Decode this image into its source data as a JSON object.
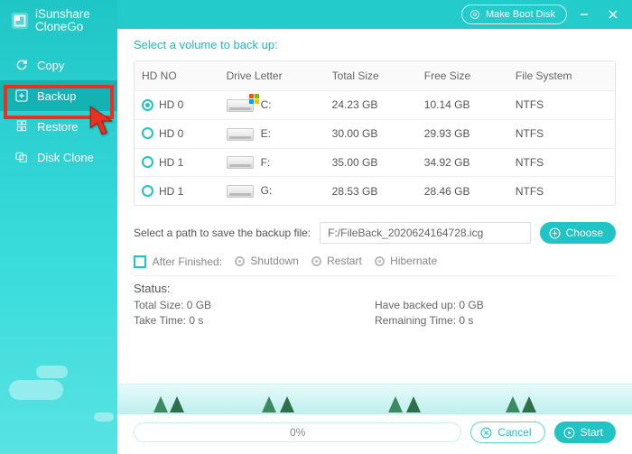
{
  "header": {
    "brand_line1": "iSunshare",
    "brand_line2": "CloneGo",
    "make_boot_disk": "Make Boot Disk"
  },
  "sidebar": {
    "items": [
      {
        "label": "Copy"
      },
      {
        "label": "Backup"
      },
      {
        "label": "Restore"
      },
      {
        "label": "Disk Clone"
      }
    ]
  },
  "volumes": {
    "title": "Select a volume to back up:",
    "columns": [
      "HD NO",
      "Drive Letter",
      "Total Size",
      "Free Size",
      "File System"
    ],
    "rows": [
      {
        "hd": "HD 0",
        "letter": "C:",
        "total": "24.23 GB",
        "free": "10.14 GB",
        "fs": "NTFS",
        "win": true,
        "checked": true
      },
      {
        "hd": "HD 0",
        "letter": "E:",
        "total": "30.00 GB",
        "free": "29.93 GB",
        "fs": "NTFS",
        "win": false,
        "checked": false
      },
      {
        "hd": "HD 1",
        "letter": "F:",
        "total": "35.00 GB",
        "free": "34.92 GB",
        "fs": "NTFS",
        "win": false,
        "checked": false
      },
      {
        "hd": "HD 1",
        "letter": "G:",
        "total": "28.53 GB",
        "free": "28.46 GB",
        "fs": "NTFS",
        "win": false,
        "checked": false
      }
    ]
  },
  "path": {
    "label": "Select a path to save the backup file:",
    "value": "F:/FileBack_2020624164728.icg",
    "choose": "Choose"
  },
  "after": {
    "label": "After Finished:",
    "opts": [
      "Shutdown",
      "Restart",
      "Hibernate"
    ]
  },
  "status": {
    "title": "Status:",
    "total_size": "Total Size: 0 GB",
    "have": "Have backed up: 0 GB",
    "take": "Take Time: 0 s",
    "remain": "Remaining Time: 0 s"
  },
  "footer": {
    "percent": "0%",
    "cancel": "Cancel",
    "start": "Start"
  }
}
